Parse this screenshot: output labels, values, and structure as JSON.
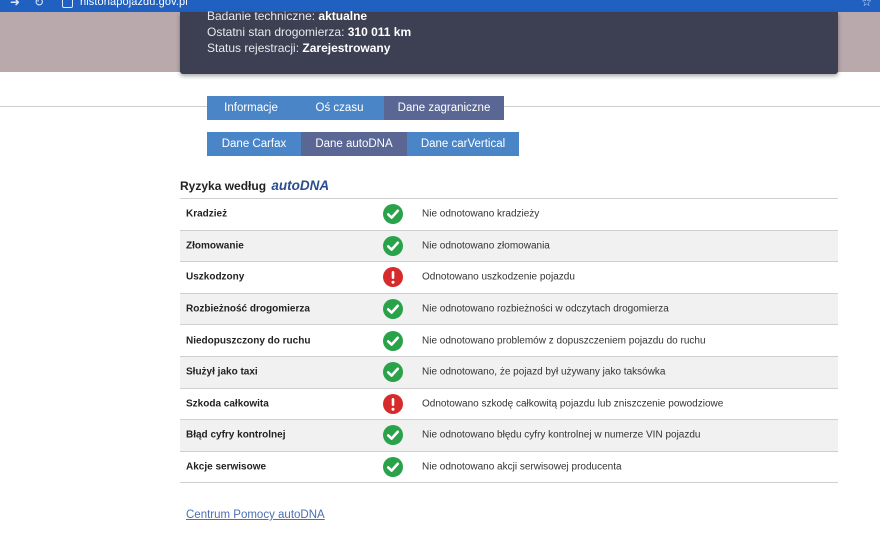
{
  "browser": {
    "back_glyph": "➜",
    "reload_glyph": "↻",
    "url": "historiapojazdu.gov.pl",
    "star_glyph": "☆",
    "site_icon": "site-info-icon"
  },
  "vehicle_card": {
    "rows": [
      {
        "label": "Badanie techniczne:",
        "value": "aktualne"
      },
      {
        "label": "Ostatni stan drogomierza:",
        "value": "310 011 km"
      },
      {
        "label": "Status rejestracji:",
        "value": "Zarejestrowany"
      }
    ]
  },
  "tabs_primary": [
    {
      "label": "Informacje",
      "active": false
    },
    {
      "label": "Oś czasu",
      "active": false
    },
    {
      "label": "Dane zagraniczne",
      "active": true
    }
  ],
  "tabs_secondary": [
    {
      "label": "Dane Carfax",
      "active": false
    },
    {
      "label": "Dane autoDNA",
      "active": true
    },
    {
      "label": "Dane carVertical",
      "active": false
    }
  ],
  "section": {
    "title_prefix": "Ryzyka według",
    "title_brand": "autoDNA"
  },
  "risks": [
    {
      "label": "Kradzież",
      "status": "ok",
      "icon": "check-circle-icon",
      "description": "Nie odnotowano kradzieży"
    },
    {
      "label": "Złomowanie",
      "status": "ok",
      "icon": "check-circle-icon",
      "description": "Nie odnotowano złomowania"
    },
    {
      "label": "Uszkodzony",
      "status": "warn",
      "icon": "exclamation-circle-icon",
      "description": "Odnotowano uszkodzenie pojazdu"
    },
    {
      "label": "Rozbieżność drogomierza",
      "status": "ok",
      "icon": "check-circle-icon",
      "description": "Nie odnotowano rozbieżności w odczytach drogomierza"
    },
    {
      "label": "Niedopuszczony do ruchu",
      "status": "ok",
      "icon": "check-circle-icon",
      "description": "Nie odnotowano problemów z dopuszczeniem pojazdu do ruchu"
    },
    {
      "label": "Służył jako taxi",
      "status": "ok",
      "icon": "check-circle-icon",
      "description": "Nie odnotowano, że pojazd był używany jako taksówka"
    },
    {
      "label": "Szkoda całkowita",
      "status": "warn",
      "icon": "exclamation-circle-icon",
      "description": "Odnotowano szkodę całkowitą pojazdu lub zniszczenie powodziowe"
    },
    {
      "label": "Błąd cyfry kontrolnej",
      "status": "ok",
      "icon": "check-circle-icon",
      "description": "Nie odnotowano błędu cyfry kontrolnej w numerze VIN pojazdu"
    },
    {
      "label": "Akcje serwisowe",
      "status": "ok",
      "icon": "check-circle-icon",
      "description": "Nie odnotowano akcji serwisowej producenta"
    }
  ],
  "help_link": "Centrum Pomocy autoDNA",
  "colors": {
    "ok": "#2aa24a",
    "warn": "#d72b2b",
    "tab": "#4a86c7",
    "tab_active": "#5a6794",
    "card": "#3d3f53"
  }
}
